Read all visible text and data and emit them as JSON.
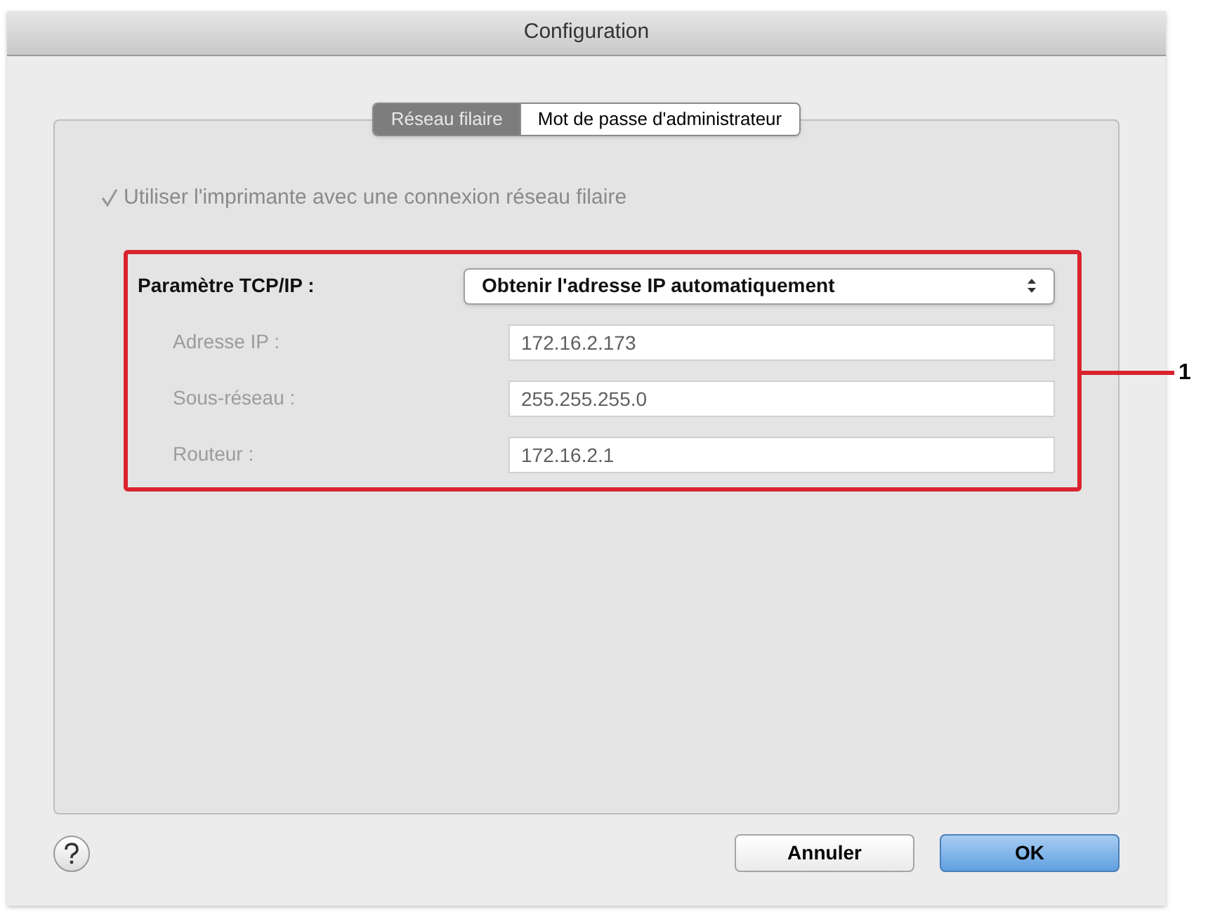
{
  "window": {
    "title": "Configuration"
  },
  "tabs": [
    {
      "label": "Réseau filaire",
      "selected": true
    },
    {
      "label": "Mot de passe d'administrateur",
      "selected": false
    }
  ],
  "wired_checkbox": {
    "label": "Utiliser l'imprimante avec une connexion réseau filaire",
    "checked": true,
    "disabled": true
  },
  "tcpip": {
    "label": "Paramètre TCP/IP :",
    "value": "Obtenir l'adresse IP automatiquement"
  },
  "fields": [
    {
      "label": "Adresse IP :",
      "value": "172.16.2.173",
      "disabled": true
    },
    {
      "label": "Sous-réseau :",
      "value": "255.255.255.0",
      "disabled": true
    },
    {
      "label": "Routeur :",
      "value": "172.16.2.1",
      "disabled": true
    }
  ],
  "callout": {
    "label": "1"
  },
  "buttons": [
    {
      "label": "Annuler",
      "kind": "cancel"
    },
    {
      "label": "OK",
      "kind": "default"
    }
  ]
}
